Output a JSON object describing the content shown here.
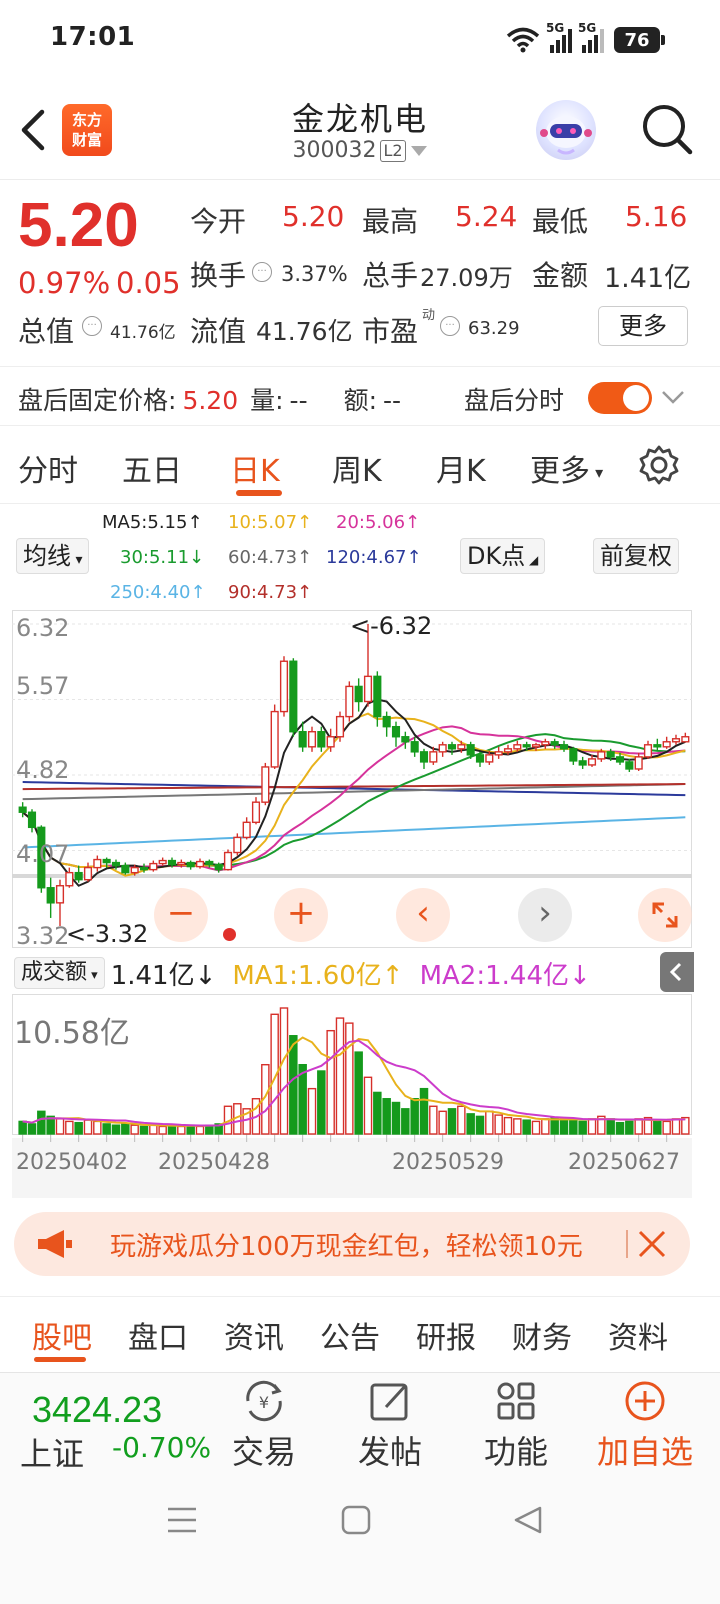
{
  "status": {
    "time": "17:01",
    "sig1": "5G",
    "sig2": "5G",
    "battery": "76"
  },
  "header": {
    "name": "金龙机电",
    "code": "300032",
    "level": "L2",
    "logo_line1": "东方",
    "logo_line2": "财富"
  },
  "quote": {
    "price": "5.20",
    "pct": "0.97%",
    "change": "0.05",
    "open_label": "今开",
    "open": "5.20",
    "high_label": "最高",
    "high": "5.24",
    "low_label": "最低",
    "low": "5.16",
    "turnover_label": "换手",
    "turnover": "3.37%",
    "volume_label": "总手",
    "volume": "27.09万",
    "amount_label": "金额",
    "amount": "1.41亿",
    "mcap_label": "总值",
    "mcap": "41.76亿",
    "float_label": "流值",
    "float": "41.76亿",
    "pe_label": "市盈",
    "pe_sup": "动",
    "pe": "63.29",
    "more": "更多"
  },
  "after_hours": {
    "label": "盘后固定价格:",
    "price": "5.20",
    "vol_label": "量:",
    "vol": "--",
    "amt_label": "额:",
    "amt": "--",
    "toggle_label": "盘后分时",
    "toggle_on": true
  },
  "chart_tabs": {
    "items": [
      "分时",
      "五日",
      "日K",
      "周K",
      "月K",
      "更多"
    ],
    "active": "日K"
  },
  "ma_legend": {
    "ma5": "MA5:5.15↑",
    "ma10": "10:5.07↑",
    "ma20": "20:5.06↑",
    "ma30": "30:5.11↓",
    "ma60": "60:4.73↑",
    "ma120": "120:4.67↑",
    "ma250": "250:4.40↑",
    "ma90": "90:4.73↑",
    "mode": "均线",
    "dk": "DK点",
    "adjust": "前复权",
    "colors": {
      "ma5": "#222222",
      "ma10": "#e8b21c",
      "ma20": "#d6339b",
      "ma30": "#1a9b2f",
      "ma60": "#777777",
      "ma120": "#2b3a9b",
      "ma250": "#5ab4e5",
      "ma90": "#b3302b"
    }
  },
  "chart_data": {
    "type": "candlestick",
    "y_ticks": [
      "6.32",
      "5.57",
      "4.82",
      "4.07",
      "3.32"
    ],
    "ylim": [
      3.32,
      6.32
    ],
    "max_marker": "<-6.32",
    "min_marker": "<-3.32",
    "dates": [
      "20250402",
      "20250428",
      "20250529",
      "20250627"
    ],
    "candles": [
      [
        4.5,
        4.45,
        4.55,
        4.4
      ],
      [
        4.45,
        4.3,
        4.48,
        4.25
      ],
      [
        4.3,
        3.7,
        4.32,
        3.65
      ],
      [
        3.7,
        3.55,
        3.8,
        3.4
      ],
      [
        3.55,
        3.72,
        3.78,
        3.32
      ],
      [
        3.72,
        3.85,
        3.9,
        3.7
      ],
      [
        3.85,
        3.78,
        3.92,
        3.75
      ],
      [
        3.78,
        3.9,
        3.95,
        3.76
      ],
      [
        3.9,
        3.98,
        4.02,
        3.86
      ],
      [
        3.98,
        3.95,
        4.0,
        3.9
      ],
      [
        3.95,
        3.92,
        3.98,
        3.88
      ],
      [
        3.92,
        3.85,
        3.95,
        3.83
      ],
      [
        3.85,
        3.9,
        3.93,
        3.82
      ],
      [
        3.9,
        3.88,
        3.94,
        3.85
      ],
      [
        3.88,
        3.94,
        3.97,
        3.86
      ],
      [
        3.94,
        3.97,
        4.0,
        3.92
      ],
      [
        3.97,
        3.93,
        4.0,
        3.9
      ],
      [
        3.93,
        3.95,
        3.98,
        3.9
      ],
      [
        3.95,
        3.91,
        3.97,
        3.88
      ],
      [
        3.91,
        3.96,
        3.99,
        3.89
      ],
      [
        3.96,
        3.93,
        3.98,
        3.9
      ],
      [
        3.93,
        3.88,
        3.95,
        3.85
      ],
      [
        3.88,
        4.05,
        4.08,
        3.87
      ],
      [
        4.05,
        4.2,
        4.24,
        4.02
      ],
      [
        4.2,
        4.35,
        4.4,
        4.18
      ],
      [
        4.35,
        4.55,
        4.6,
        4.33
      ],
      [
        4.55,
        4.9,
        4.94,
        4.52
      ],
      [
        4.9,
        5.45,
        5.52,
        4.88
      ],
      [
        5.45,
        5.95,
        6.0,
        5.4
      ],
      [
        5.95,
        5.25,
        5.98,
        5.2
      ],
      [
        5.25,
        5.1,
        5.35,
        5.05
      ],
      [
        5.1,
        5.25,
        5.3,
        5.05
      ],
      [
        5.25,
        5.1,
        5.3,
        5.05
      ],
      [
        5.1,
        5.2,
        5.28,
        5.05
      ],
      [
        5.2,
        5.4,
        5.45,
        5.15
      ],
      [
        5.4,
        5.7,
        5.75,
        5.35
      ],
      [
        5.7,
        5.55,
        5.78,
        5.45
      ],
      [
        5.55,
        5.8,
        6.32,
        5.5
      ],
      [
        5.8,
        5.4,
        5.85,
        5.3
      ],
      [
        5.4,
        5.3,
        5.45,
        5.2
      ],
      [
        5.3,
        5.2,
        5.35,
        5.1
      ],
      [
        5.2,
        5.15,
        5.25,
        5.08
      ],
      [
        5.15,
        5.05,
        5.2,
        5.0
      ],
      [
        5.05,
        4.95,
        5.08,
        4.88
      ],
      [
        4.95,
        5.05,
        5.1,
        4.92
      ],
      [
        5.05,
        5.12,
        5.15,
        5.0
      ],
      [
        5.12,
        5.08,
        5.15,
        5.02
      ],
      [
        5.08,
        5.12,
        5.16,
        5.04
      ],
      [
        5.12,
        5.02,
        5.15,
        4.98
      ],
      [
        5.02,
        4.95,
        5.05,
        4.9
      ],
      [
        4.95,
        5.02,
        5.06,
        4.92
      ],
      [
        5.02,
        5.05,
        5.1,
        4.98
      ],
      [
        5.05,
        5.08,
        5.12,
        5.02
      ],
      [
        5.08,
        5.12,
        5.16,
        5.05
      ],
      [
        5.12,
        5.1,
        5.15,
        5.06
      ],
      [
        5.1,
        5.12,
        5.14,
        5.06
      ],
      [
        5.12,
        5.15,
        5.18,
        5.08
      ],
      [
        5.15,
        5.12,
        5.18,
        5.08
      ],
      [
        5.12,
        5.08,
        5.16,
        5.05
      ],
      [
        5.08,
        4.96,
        5.1,
        4.92
      ],
      [
        4.96,
        4.92,
        5.0,
        4.88
      ],
      [
        4.92,
        4.98,
        5.02,
        4.9
      ],
      [
        4.98,
        5.05,
        5.08,
        4.95
      ],
      [
        5.05,
        5.0,
        5.08,
        4.96
      ],
      [
        5.0,
        4.95,
        5.04,
        4.92
      ],
      [
        4.95,
        4.88,
        4.98,
        4.85
      ],
      [
        4.88,
        5.0,
        5.04,
        4.86
      ],
      [
        5.0,
        5.12,
        5.16,
        4.98
      ],
      [
        5.12,
        5.1,
        5.18,
        5.06
      ],
      [
        5.1,
        5.15,
        5.2,
        5.08
      ],
      [
        5.15,
        5.18,
        5.22,
        5.12
      ],
      [
        5.15,
        5.2,
        5.24,
        5.16
      ]
    ],
    "volume": {
      "scale_label": "10.58亿",
      "values": [
        0.1,
        0.08,
        0.18,
        0.14,
        0.12,
        0.1,
        0.09,
        0.11,
        0.1,
        0.08,
        0.07,
        0.08,
        0.07,
        0.06,
        0.07,
        0.06,
        0.07,
        0.06,
        0.07,
        0.06,
        0.07,
        0.08,
        0.22,
        0.24,
        0.2,
        0.28,
        0.55,
        0.95,
        1.0,
        0.78,
        0.55,
        0.36,
        0.5,
        0.82,
        0.92,
        0.88,
        0.65,
        0.45,
        0.33,
        0.28,
        0.25,
        0.2,
        0.28,
        0.36,
        0.22,
        0.18,
        0.2,
        0.22,
        0.16,
        0.14,
        0.18,
        0.15,
        0.13,
        0.12,
        0.11,
        0.1,
        0.12,
        0.13,
        0.12,
        0.11,
        0.1,
        0.12,
        0.14,
        0.12,
        0.09,
        0.1,
        0.12,
        0.13,
        0.11,
        0.1,
        0.12,
        0.13
      ]
    }
  },
  "vol_legend": {
    "select": "成交额",
    "amount": "1.41亿↓",
    "ma1": "MA1:1.60亿↑",
    "ma2": "MA2:1.44亿↓"
  },
  "banner": {
    "text": "玩游戏瓜分100万现金红包，轻松领10元"
  },
  "bottom_tabs": {
    "items": [
      "股吧",
      "盘口",
      "资讯",
      "公告",
      "研报",
      "财务",
      "资料"
    ],
    "active": "股吧"
  },
  "bottom_bar": {
    "index_value": "3424.23",
    "index_name": "上证",
    "index_pct": "-0.70%",
    "trade": "交易",
    "post": "发帖",
    "func": "功能",
    "add": "加自选"
  },
  "zoom": {
    "minus": "−",
    "plus": "+",
    "left": "‹",
    "right": "›"
  }
}
